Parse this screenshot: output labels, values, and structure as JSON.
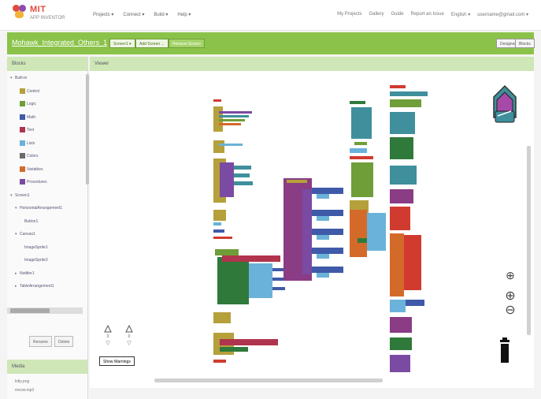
{
  "logo": {
    "title": "MIT",
    "subtitle": "APP INVENTOR"
  },
  "top_menu": [
    "Projects ▾",
    "Connect ▾",
    "Build ▾",
    "Help ▾"
  ],
  "top_links": [
    "My Projects",
    "Gallery",
    "Guide",
    "Report an Issue",
    "English ▾",
    "username@gmail.com ▾"
  ],
  "project": {
    "name": "Mohawk_Integrated_Others_1"
  },
  "green_buttons": [
    "Screen1 ▾",
    "Add Screen ...",
    "Remove Screen"
  ],
  "mode_buttons": [
    "Designer",
    "Blocks"
  ],
  "panel_title": "Blocks",
  "tree": [
    {
      "label": "Built-in",
      "indent": 0,
      "arrow": "▾",
      "color": ""
    },
    {
      "label": "Control",
      "indent": 2,
      "arrow": "",
      "color": "#b5a03b"
    },
    {
      "label": "Logic",
      "indent": 2,
      "arrow": "",
      "color": "#6f9d38"
    },
    {
      "label": "Math",
      "indent": 2,
      "arrow": "",
      "color": "#3f5aa8"
    },
    {
      "label": "Text",
      "indent": 2,
      "arrow": "",
      "color": "#b0344d"
    },
    {
      "label": "Lists",
      "indent": 2,
      "arrow": "",
      "color": "#6ab2d9"
    },
    {
      "label": "Colors",
      "indent": 2,
      "arrow": "",
      "color": "#6a6a6a"
    },
    {
      "label": "Variables",
      "indent": 2,
      "arrow": "",
      "color": "#d46a2a"
    },
    {
      "label": "Procedures",
      "indent": 2,
      "arrow": "",
      "color": "#7b4aa3"
    },
    {
      "label": "Screen1",
      "indent": 0,
      "arrow": "▾",
      "color": ""
    },
    {
      "label": "HorizontalArrangement1",
      "indent": 1,
      "arrow": "▾",
      "color": ""
    },
    {
      "label": "Button1",
      "indent": 3,
      "arrow": "",
      "color": ""
    },
    {
      "label": "Canvas1",
      "indent": 1,
      "arrow": "▾",
      "color": ""
    },
    {
      "label": "ImageSprite1",
      "indent": 3,
      "arrow": "",
      "color": ""
    },
    {
      "label": "ImageSprite2",
      "indent": 3,
      "arrow": "",
      "color": ""
    },
    {
      "label": "Notifier1",
      "indent": 1,
      "arrow": "▸",
      "color": ""
    },
    {
      "label": "TableArrangement1",
      "indent": 1,
      "arrow": "▸",
      "color": ""
    }
  ],
  "panel_buttons": [
    "Rename",
    "Delete"
  ],
  "media_title": "Media",
  "media_items": [
    "kitty.png",
    "meow.mp3"
  ],
  "viewer_title": "Viewer",
  "warnings": {
    "warning_count": "0",
    "error_count": "0",
    "toggle_label": "Show Warnings"
  },
  "workspace_controls": [
    "center-icon",
    "zoom-in-icon",
    "zoom-out-icon"
  ],
  "colors": {
    "brand_green": "#8bc34a",
    "panel_head": "#cfe6b6"
  }
}
